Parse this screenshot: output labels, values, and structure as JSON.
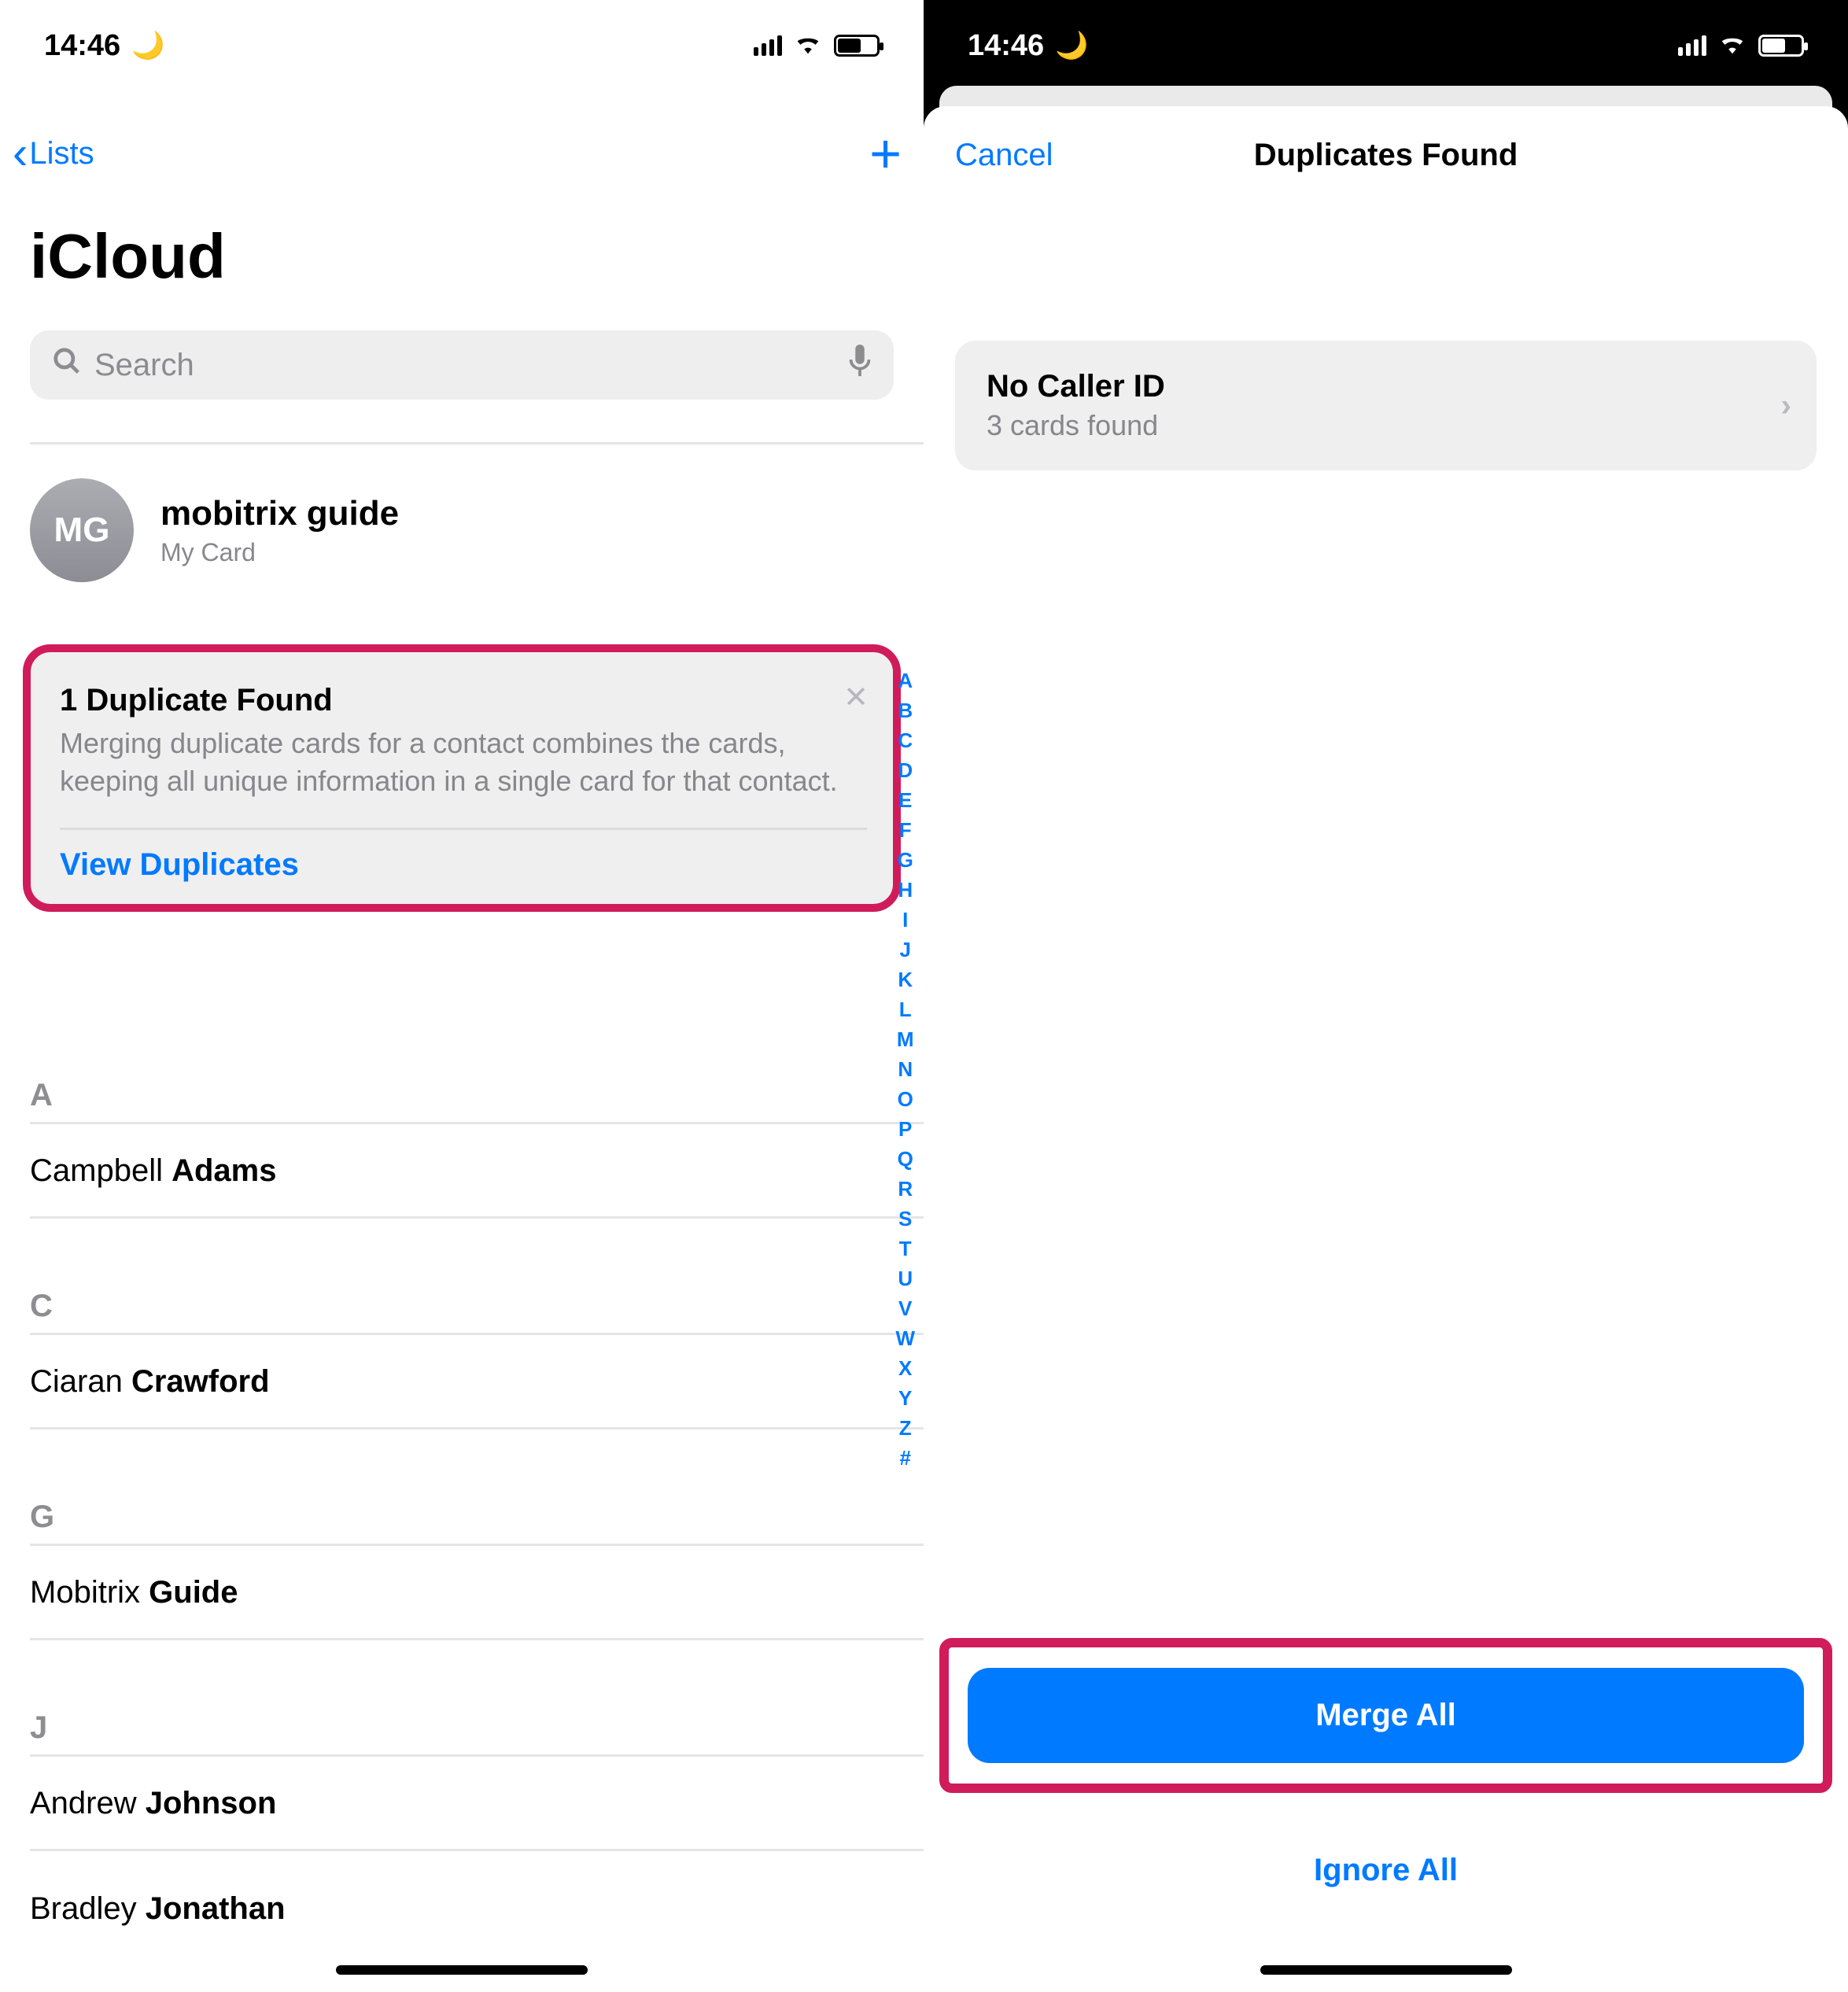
{
  "status": {
    "time": "14:46"
  },
  "left": {
    "back_label": "Lists",
    "title": "iCloud",
    "search_placeholder": "Search",
    "my_card": {
      "initials": "MG",
      "name": "mobitrix guide",
      "subtitle": "My Card"
    },
    "dup_card": {
      "title": "1 Duplicate Found",
      "description": "Merging duplicate cards for a contact combines the cards, keeping all unique information in a single card for that contact.",
      "action": "View Duplicates"
    },
    "sections": [
      {
        "letter": "A",
        "contacts": [
          {
            "first": "Campbell ",
            "last": "Adams"
          }
        ]
      },
      {
        "letter": "C",
        "contacts": [
          {
            "first": "Ciaran ",
            "last": "Crawford"
          }
        ]
      },
      {
        "letter": "G",
        "contacts": [
          {
            "first": "Mobitrix ",
            "last": "Guide"
          }
        ]
      },
      {
        "letter": "J",
        "contacts": [
          {
            "first": "Andrew ",
            "last": "Johnson"
          },
          {
            "first": "Bradley ",
            "last": "Jonathan"
          }
        ]
      }
    ],
    "index": [
      "A",
      "B",
      "C",
      "D",
      "E",
      "F",
      "G",
      "H",
      "I",
      "J",
      "K",
      "L",
      "M",
      "N",
      "O",
      "P",
      "Q",
      "R",
      "S",
      "T",
      "U",
      "V",
      "W",
      "X",
      "Y",
      "Z",
      "#"
    ]
  },
  "right": {
    "cancel": "Cancel",
    "title": "Duplicates Found",
    "item": {
      "name": "No Caller ID",
      "subtitle": "3 cards found"
    },
    "merge": "Merge All",
    "ignore": "Ignore All"
  }
}
